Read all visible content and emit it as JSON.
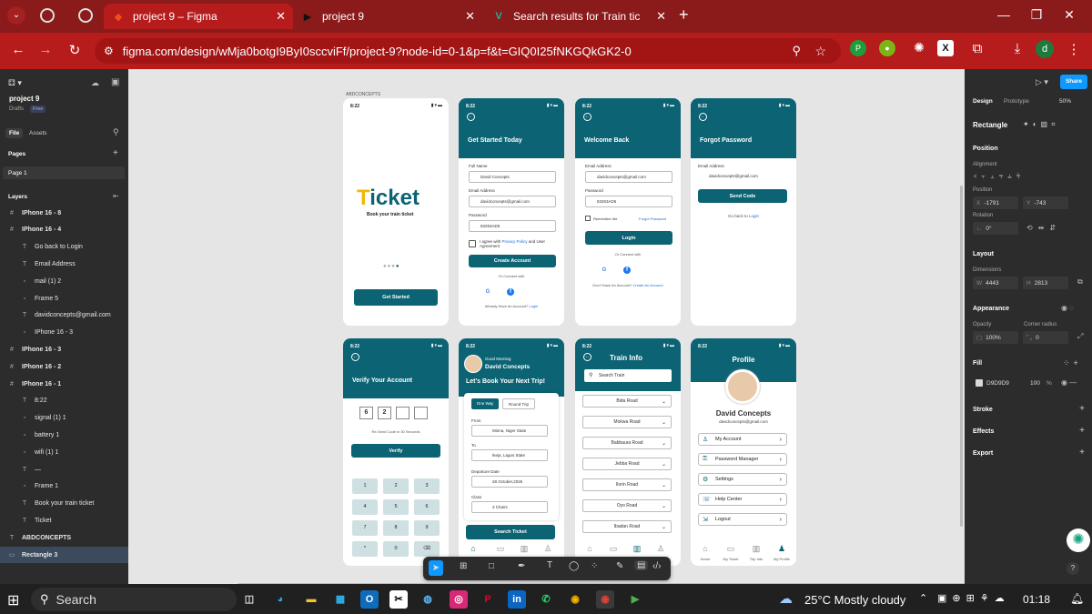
{
  "browser": {
    "tabs": [
      {
        "label": "project 9 – Figma",
        "icon": "figma-icon"
      },
      {
        "label": "project 9",
        "icon": "play-icon"
      },
      {
        "label": "Search results for Train ticket - V",
        "icon": "v-icon"
      }
    ],
    "url": "figma.com/design/wMja0botgI9ByI0sccviFf/project-9?node-id=0-1&p=f&t=GIQ0I25fNKGQkGK2-0",
    "profile_initial": "d"
  },
  "figma": {
    "file_name": "project 9",
    "drafts": "Drafts",
    "plan": "Free",
    "tabs": [
      "File",
      "Assets"
    ],
    "pages_label": "Pages",
    "page": "Page 1",
    "layers_label": "Layers",
    "layers": [
      {
        "label": "IPhone 16 - 8",
        "indent": 0,
        "icon": "#"
      },
      {
        "label": "IPhone 16 - 4",
        "indent": 0,
        "icon": "#"
      },
      {
        "label": "Go back to Login",
        "indent": 1,
        "icon": "T"
      },
      {
        "label": "Email Address",
        "indent": 1,
        "icon": "T"
      },
      {
        "label": "mail (1) 2",
        "indent": 1,
        "icon": "▫"
      },
      {
        "label": "Frame 5",
        "indent": 1,
        "icon": "▫"
      },
      {
        "label": "davidconcepts@gmail.com",
        "indent": 1,
        "icon": "T"
      },
      {
        "label": "IPhone 16 - 3",
        "indent": 1,
        "icon": "▫"
      },
      {
        "label": "IPhone 16 - 3",
        "indent": 0,
        "icon": "#"
      },
      {
        "label": "IPhone 16 - 2",
        "indent": 0,
        "icon": "#"
      },
      {
        "label": "IPhone 16 - 1",
        "indent": 0,
        "icon": "#"
      },
      {
        "label": "8:22",
        "indent": 1,
        "icon": "T"
      },
      {
        "label": "signal (1) 1",
        "indent": 1,
        "icon": "▫"
      },
      {
        "label": "battery 1",
        "indent": 1,
        "icon": "▫"
      },
      {
        "label": "wifi (1) 1",
        "indent": 1,
        "icon": "▫"
      },
      {
        "label": "—",
        "indent": 1,
        "icon": "T"
      },
      {
        "label": "Frame 1",
        "indent": 1,
        "icon": "▫"
      },
      {
        "label": "Book your train ticket",
        "indent": 1,
        "icon": "T"
      },
      {
        "label": "Ticket",
        "indent": 1,
        "icon": "T"
      },
      {
        "label": "ABDCONCEPTS",
        "indent": 0,
        "icon": "T"
      },
      {
        "label": "Rectangle 3",
        "indent": 0,
        "icon": "▭",
        "selected": true
      }
    ],
    "right": {
      "tabs": [
        "Design",
        "Prototype"
      ],
      "zoom": "50%",
      "share": "Share",
      "selection": "Rectangle",
      "position": "Position",
      "alignment": "Alignment",
      "position_label": "Position",
      "x": "-1791",
      "y": "-743",
      "rotation_label": "Rotation",
      "rotation": "0°",
      "layout": "Layout",
      "dimensions": "Dimensions",
      "w": "4443",
      "h": "2813",
      "appearance": "Appearance",
      "opacity_label": "Opacity",
      "opacity": "100%",
      "radius_label": "Corner radius",
      "radius": "0",
      "fill": "Fill",
      "fill_hex": "D9D9D9",
      "fill_opacity": "100",
      "fill_pct": "%",
      "stroke": "Stroke",
      "effects": "Effects",
      "export": "Export"
    }
  },
  "canvas": {
    "frame_label": "ABDCONCEPTS",
    "splash": {
      "time": "8:22",
      "logo_t": "T",
      "logo_rest": "icket",
      "tagline": "Book your train ticket",
      "cta": "Get Started"
    },
    "signup": {
      "time": "8:22",
      "title": "Get Started Today",
      "name_label": "Full Name",
      "name": "David Concepts",
      "email_label": "Email Address",
      "email": "davidconcepts@gmail.com",
      "pw_label": "Password",
      "pw": "83263AD5",
      "agree_pre": "I agree with ",
      "agree_link": "Privacy Policy",
      "agree_post": " and User Agreement",
      "cta": "Create Account",
      "or": "Or Connect with",
      "have_pre": "Already Have An Account? ",
      "have_link": "Login"
    },
    "login": {
      "time": "8:22",
      "title": "Welcome Back",
      "email_label": "Email Address",
      "email": "davidconcepts@gmail.com",
      "pw_label": "Password",
      "pw": "83263AD5",
      "remember": "Remember Me",
      "forgot": "Forgot Password",
      "cta": "Login",
      "or": "Or Connect with",
      "no_pre": "Don't Have An Account? ",
      "no_link": "Create An Account"
    },
    "forgot": {
      "time": "8:22",
      "title": "Forgot Password",
      "email_label": "Email Address",
      "email": "davidconcepts@gmail.com",
      "cta": "Send Code",
      "back_pre": "Go back to ",
      "back_link": "Login"
    },
    "verify": {
      "time": "8:22",
      "title": "Verify Your Account",
      "d1": "6",
      "d2": "2",
      "resend": "Re-Send Code in 30 Seconds",
      "cta": "Verify",
      "keys": [
        "1",
        "2",
        "3",
        "4",
        "5",
        "6",
        "7",
        "8",
        "9",
        "*",
        "0",
        "⌫"
      ]
    },
    "home": {
      "time": "8:22",
      "greeting": "Good Morning",
      "name": "David Concepts",
      "headline": "Let's Book Your Next Trip!",
      "oneway": "One Way",
      "round": "Round Trip",
      "from_label": "From",
      "from": "Minna, Niger State",
      "to_label": "To",
      "to": "Ikeja, Lagos State",
      "date_label": "Departure Date",
      "date": "28 October,2025",
      "class_label": "Class",
      "class": "3 Chairs",
      "cta": "Search Ticket"
    },
    "train": {
      "time": "8:22",
      "title": "Train Info",
      "search": "Search Train",
      "roads": [
        "Bida Road",
        "Mokwa Road",
        "Babbaura Road",
        "Jebba Road",
        "Ilorin Road",
        "Oyo Road",
        "Ibadan Road"
      ]
    },
    "profile": {
      "time": "8:22",
      "title": "Profile",
      "name": "David Concepts",
      "email": "davidconcepts@gmail.com",
      "menu": [
        "My Account",
        "Password Manager",
        "Settings",
        "Help Center",
        "Logout"
      ],
      "nav": [
        "Home",
        "My Ticket",
        "Trip Info",
        "My Profile"
      ]
    }
  },
  "taskbar": {
    "search": "Search",
    "weather": "25°C  Mostly cloudy",
    "time": "01:18"
  }
}
